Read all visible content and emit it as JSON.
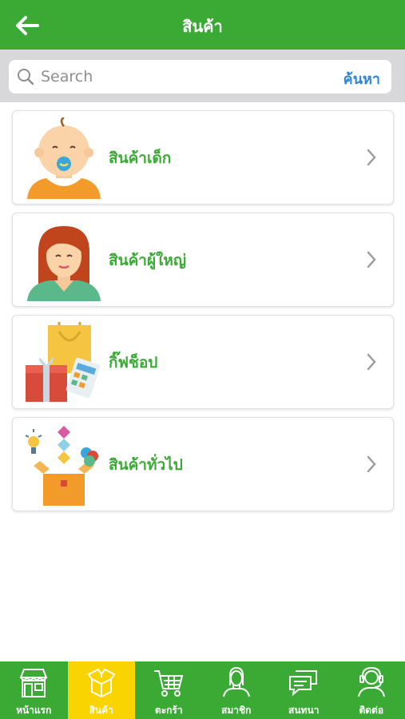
{
  "header": {
    "title": "สินค้า"
  },
  "search": {
    "placeholder": "Search",
    "button_label": "ค้นหา"
  },
  "categories": [
    {
      "label": "สินค้าเด็ก",
      "icon": "baby-icon"
    },
    {
      "label": "สินค้าผู้ใหญ่",
      "icon": "woman-icon"
    },
    {
      "label": "กิ๊ฟช็อป",
      "icon": "gift-shop-icon"
    },
    {
      "label": "สินค้าทั่วไป",
      "icon": "general-goods-icon"
    }
  ],
  "tabbar": {
    "active_index": 1,
    "items": [
      {
        "label": "หน้าแรก",
        "icon": "store-icon"
      },
      {
        "label": "สินค้า",
        "icon": "product-box-icon"
      },
      {
        "label": "ตะกร้า",
        "icon": "cart-icon"
      },
      {
        "label": "สมาชิก",
        "icon": "member-icon"
      },
      {
        "label": "สนทนา",
        "icon": "chat-icon"
      },
      {
        "label": "ติดต่อ",
        "icon": "contact-support-icon"
      }
    ]
  },
  "colors": {
    "primary": "#3aaa35",
    "active_tab": "#fad400",
    "link": "#2b86d6",
    "search_bg": "#d8d8da"
  }
}
